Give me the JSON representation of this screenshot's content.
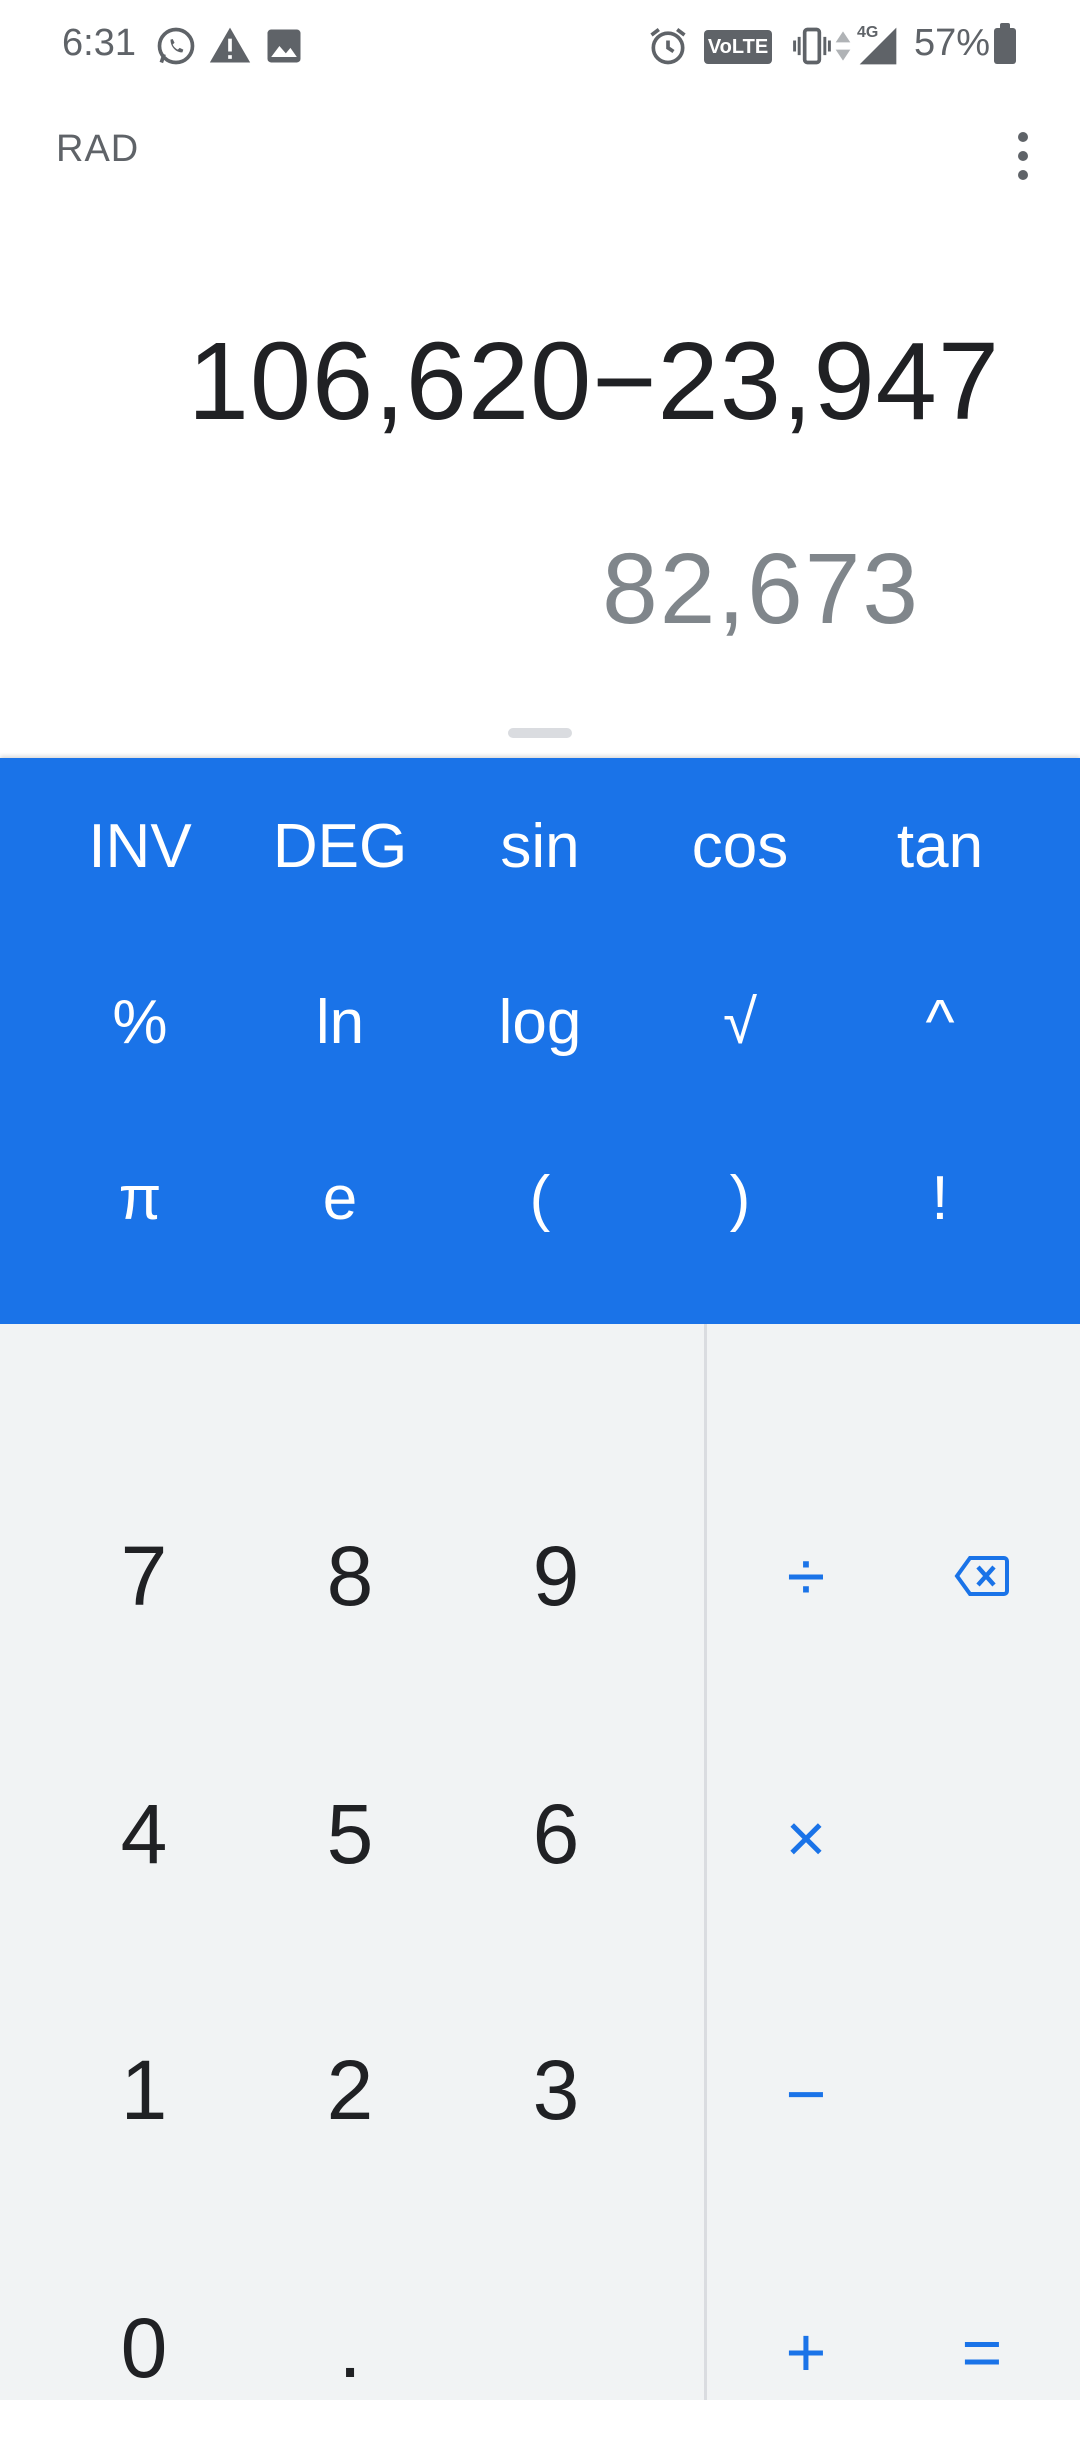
{
  "status_bar": {
    "time": "6:31",
    "icons": [
      "whatsapp-icon",
      "alert-icon",
      "image-icon",
      "alarm-icon",
      "vibrate-icon",
      "data-arrows-icon",
      "signal-icon",
      "battery-icon"
    ],
    "volte": "VoLTE",
    "network": "4G",
    "battery": "57%"
  },
  "app_bar": {
    "mode": "RAD",
    "menu_icon": "more-vert-icon"
  },
  "display": {
    "expression": "106,620−23,947",
    "result": "82,673"
  },
  "scientific": {
    "rows": [
      [
        "INV",
        "DEG",
        "sin",
        "cos",
        "tan"
      ],
      [
        "%",
        "ln",
        "log",
        "√",
        "^"
      ],
      [
        "π",
        "e",
        "(",
        ")",
        "!"
      ]
    ]
  },
  "keypad": {
    "numbers": [
      "7",
      "8",
      "9",
      "4",
      "5",
      "6",
      "1",
      "2",
      "3",
      "0",
      "."
    ],
    "operators": {
      "divide": "÷",
      "multiply": "×",
      "minus": "−",
      "plus": "+",
      "equals": "="
    },
    "backspace_icon": "backspace-icon"
  },
  "colors": {
    "accent": "#1a73e8",
    "keypad_bg": "#f1f3f4",
    "text": "#202124",
    "muted": "#80868b"
  }
}
